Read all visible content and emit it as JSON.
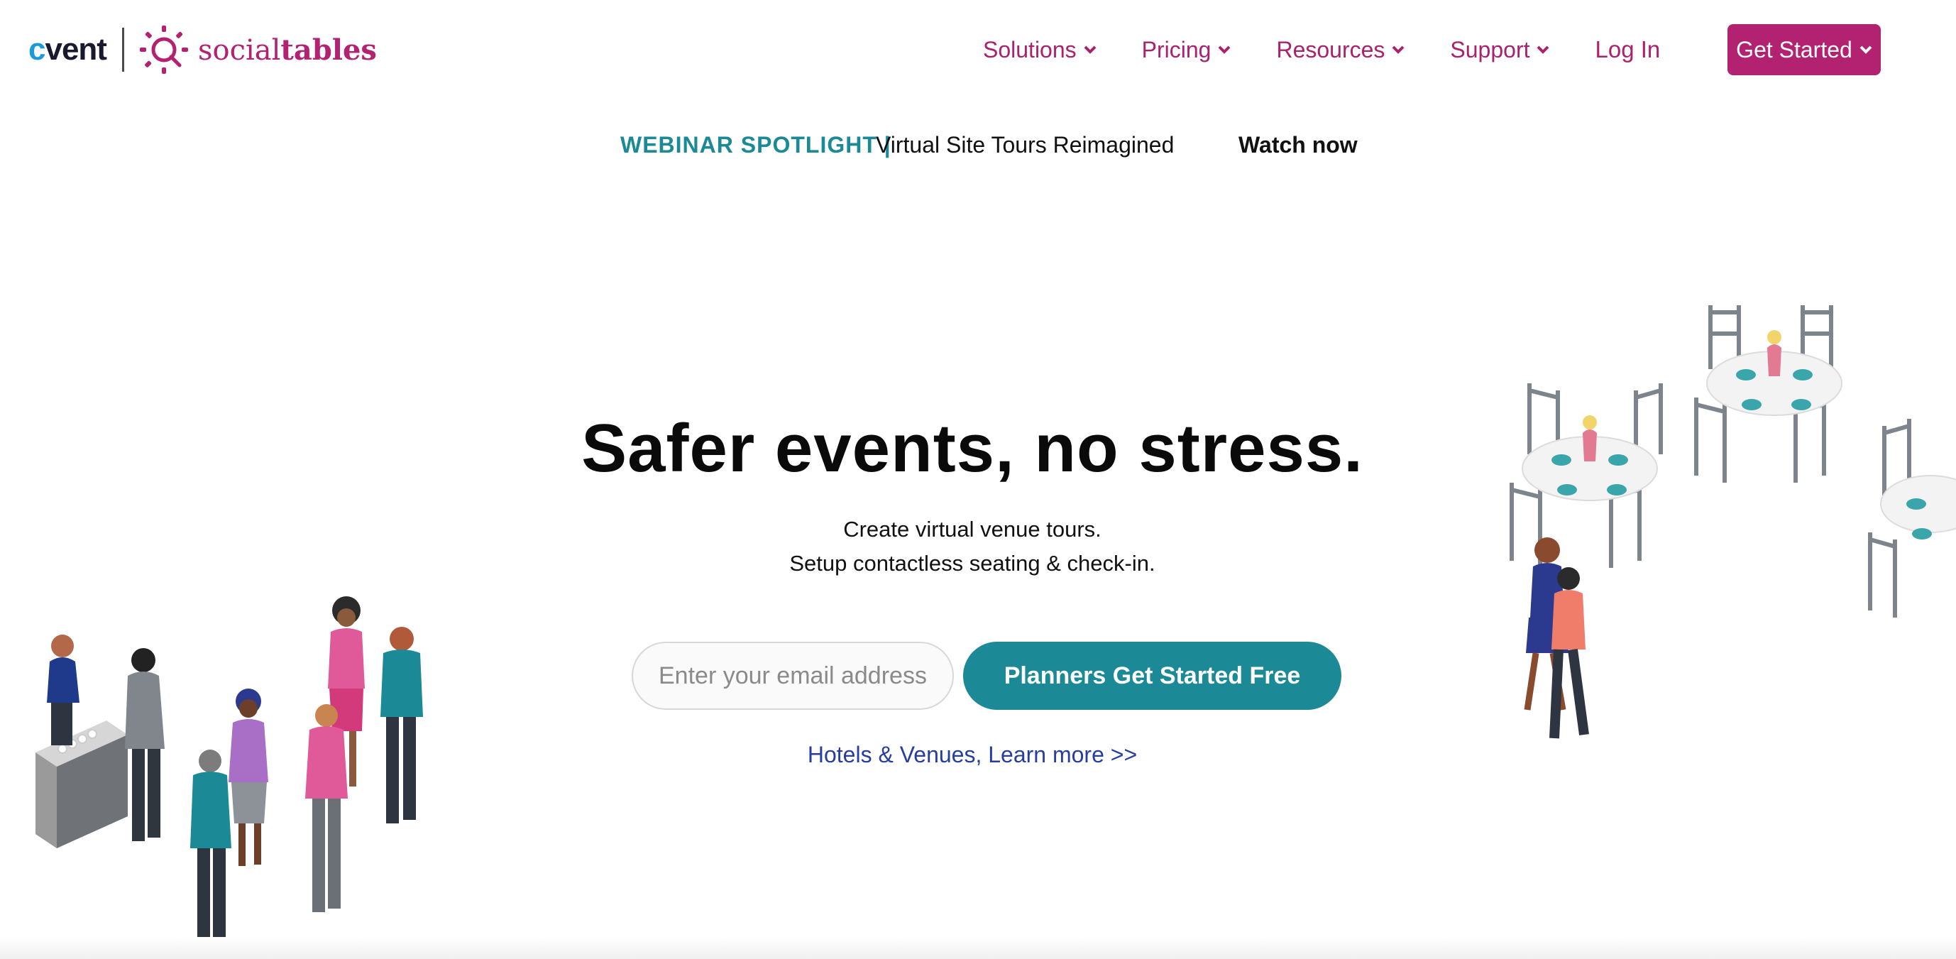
{
  "brand": {
    "cvent": "cvent",
    "socialtables_prefix": "social",
    "socialtables_bold": "tables",
    "accent": "#b22271",
    "teal": "#1b8a96",
    "link_blue": "#263ea0"
  },
  "nav": {
    "items": [
      {
        "label": "Solutions"
      },
      {
        "label": "Pricing"
      },
      {
        "label": "Resources"
      },
      {
        "label": "Support"
      }
    ],
    "login": "Log In",
    "cta": "Get Started"
  },
  "webinar": {
    "tag": "WEBINAR SPOTLIGHT |",
    "title": "Virtual Site Tours Reimagined",
    "link": "Watch now"
  },
  "hero": {
    "title": "Safer events, no stress.",
    "subtitle_line1": "Create virtual venue tours.",
    "subtitle_line2": "Setup contactless seating & check-in.",
    "email_placeholder": "Enter your email address",
    "cta": "Planners Get Started Free",
    "secondary_link": "Hotels & Venues, Learn more >>"
  }
}
